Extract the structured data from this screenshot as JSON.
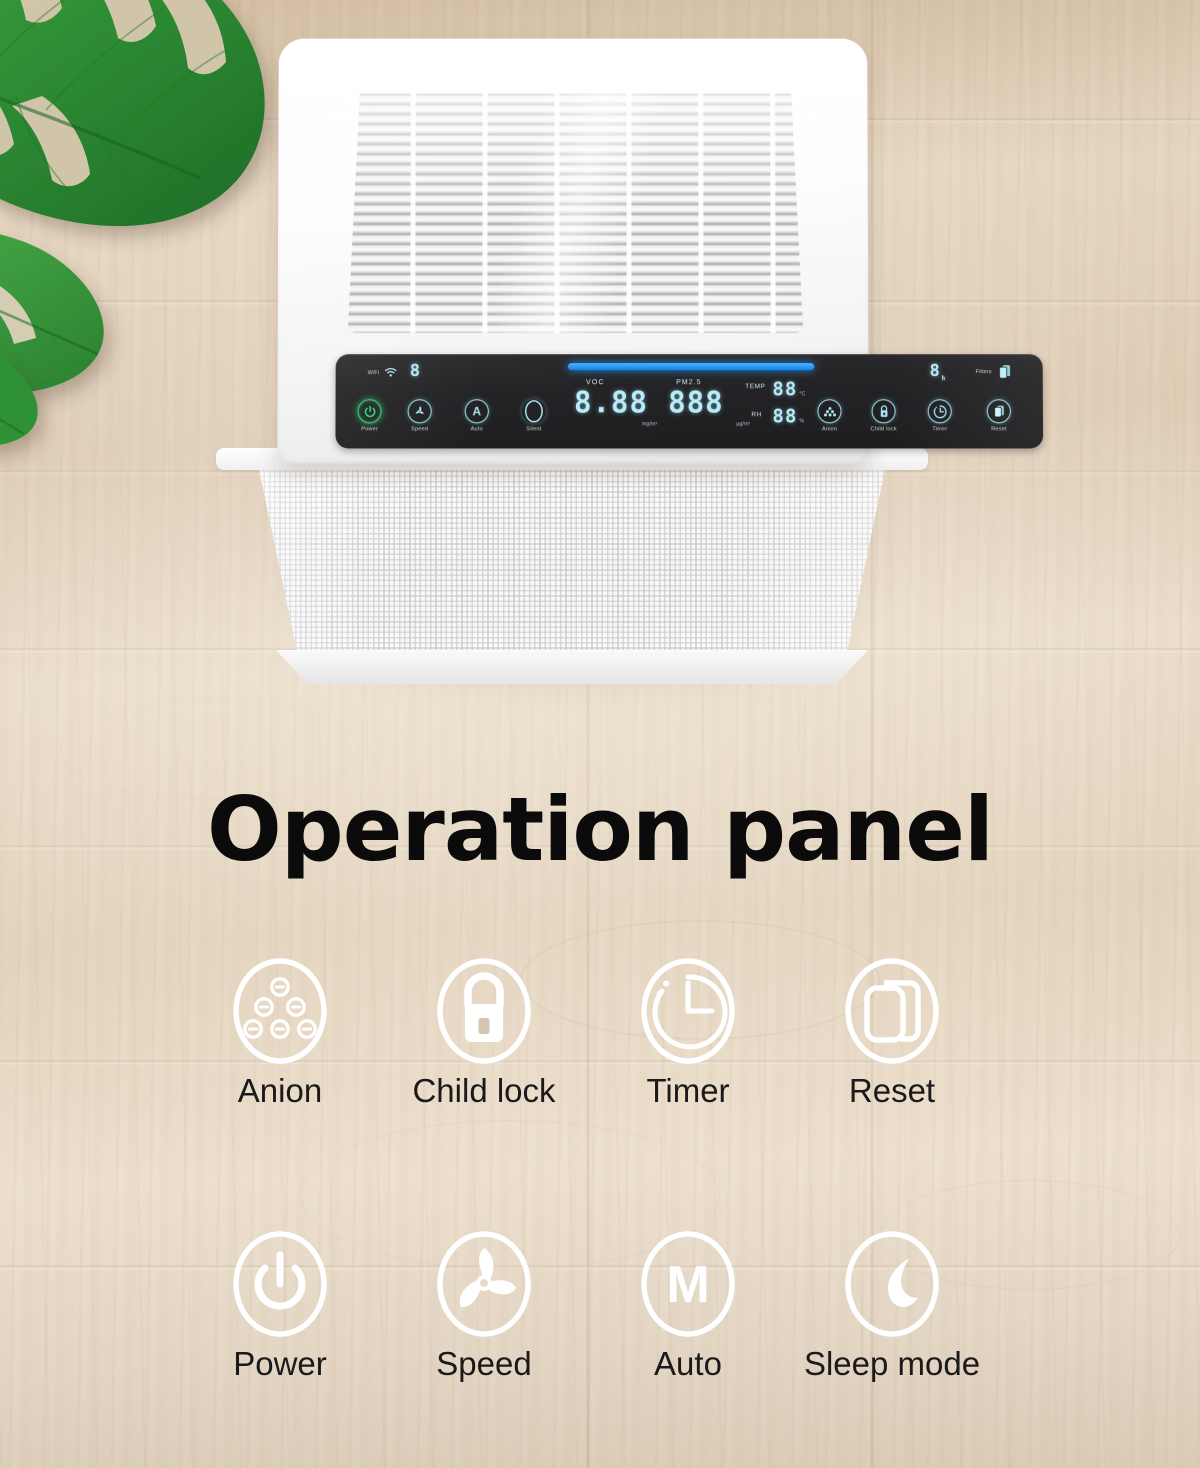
{
  "page": {
    "title": "Operation panel",
    "background": "#e2d3bf",
    "accent_blue": "#1e90ff",
    "accent_cyan": "#a8e6f2",
    "accent_green": "#35e07e"
  },
  "product": {
    "name": "air-purifier",
    "control_panel": {
      "wifi_label": "WiFi",
      "filters_label": "Filters",
      "speed_level_digit": "8",
      "timer_digit": "8",
      "timer_unit": "h",
      "readouts": [
        {
          "name": "VOC",
          "label": "VOC",
          "value": "8.88",
          "unit": "mg/m³"
        },
        {
          "name": "PM2.5",
          "label": "PM2.5",
          "value": "888",
          "unit": "µg/m³"
        },
        {
          "name": "TEMP",
          "label": "TEMP",
          "value": "88",
          "unit": "°C"
        },
        {
          "name": "RH",
          "label": "RH",
          "value": "88",
          "unit": "%"
        }
      ],
      "buttons": [
        {
          "label": "Power",
          "icon": "power-icon",
          "state": "on"
        },
        {
          "label": "Speed",
          "icon": "fan-icon",
          "state": "off"
        },
        {
          "label": "Auto",
          "icon": "auto-a-icon",
          "state": "off"
        },
        {
          "label": "Silent",
          "icon": "moon-icon",
          "state": "off"
        },
        {
          "label": "Anion",
          "icon": "anion-icon",
          "state": "off"
        },
        {
          "label": "Child lock",
          "icon": "lock-icon",
          "state": "off"
        },
        {
          "label": "Timer",
          "icon": "timer-icon",
          "state": "off"
        },
        {
          "label": "Reset",
          "icon": "filter-reset-icon",
          "state": "off"
        }
      ]
    }
  },
  "features": {
    "row1": [
      {
        "label": "Anion",
        "icon": "anion-icon"
      },
      {
        "label": "Child lock",
        "icon": "lock-icon"
      },
      {
        "label": "Timer",
        "icon": "timer-icon"
      },
      {
        "label": "Reset",
        "icon": "filter-reset-icon"
      }
    ],
    "row2": [
      {
        "label": "Power",
        "icon": "power-icon"
      },
      {
        "label": "Speed",
        "icon": "fan-icon"
      },
      {
        "label": "Auto",
        "icon": "auto-m-icon"
      },
      {
        "label": "Sleep mode",
        "icon": "moon-icon"
      }
    ]
  }
}
